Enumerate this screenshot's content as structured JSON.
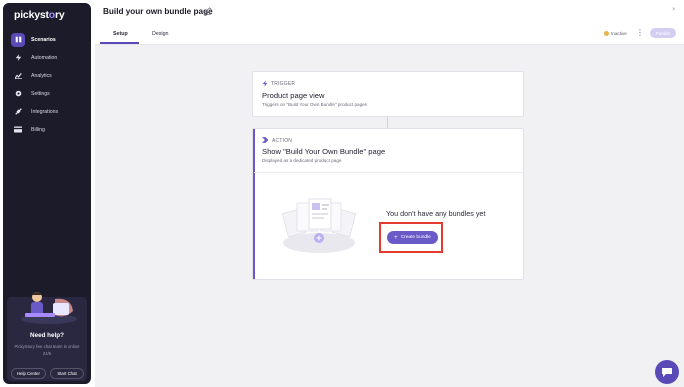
{
  "app": {
    "logo_text_a": "pickyst",
    "logo_text_b": "o",
    "logo_text_c": "ry"
  },
  "sidebar": {
    "items": [
      {
        "label": "Scenarios",
        "icon": "scenarios-icon",
        "active": true
      },
      {
        "label": "Automation",
        "icon": "bolt-icon",
        "active": false
      },
      {
        "label": "Analytics",
        "icon": "chart-icon",
        "active": false
      },
      {
        "label": "Settings",
        "icon": "gear-icon",
        "active": false
      },
      {
        "label": "Integrations",
        "icon": "plug-icon",
        "active": false
      },
      {
        "label": "Billing",
        "icon": "card-icon",
        "active": false
      }
    ],
    "help": {
      "title": "Need help?",
      "subtitle": "PickyStory live chat team is online 24/5",
      "help_center_label": "Help Center",
      "start_chat_label": "Start Chat"
    }
  },
  "header": {
    "title": "Build your own bundle page",
    "close_label": "×",
    "tabs": [
      {
        "label": "Setup",
        "active": true
      },
      {
        "label": "Design",
        "active": false
      }
    ],
    "status": "Inactive",
    "status_color": "#e8b54a",
    "publish_label": "Publish",
    "kebab": "⋮"
  },
  "flow": {
    "trigger": {
      "kind": "TRIGGER",
      "title": "Product page view",
      "subtitle": "Triggers on \"Build Your Own Bundle\" product pages"
    },
    "action": {
      "kind": "ACTION",
      "title": "Show \"Build Your Own Bundle\" page",
      "subtitle": "Displayed as a dedicated product page",
      "empty_text": "You don't have any bundles yet",
      "create_label": "Create bundle"
    }
  },
  "colors": {
    "accent": "#6a5ac8",
    "sidebar_bg": "#1b1b2a",
    "highlight": "#e53a2e"
  }
}
